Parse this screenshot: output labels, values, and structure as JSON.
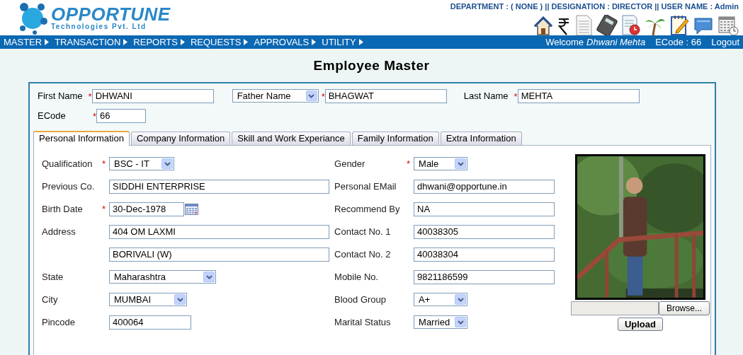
{
  "header": {
    "logo_name": "OPPORTUNE",
    "logo_sub": "Technologies Pvt. Ltd",
    "info": "DEPARTMENT : ( NONE ) || DESIGNATION : DIRECTOR || USER NAME : Admin"
  },
  "menu": [
    "MASTER",
    "TRANSACTION",
    "REPORTS",
    "REQUESTS",
    "APPROVALS",
    "UTILITY"
  ],
  "welcome": {
    "greeting": "Welcome",
    "user": "Dhwani Mehta",
    "ecode": "ECode : 66",
    "logout": "Logout"
  },
  "title": "Employee Master",
  "top_fields": [
    {
      "kind": "label",
      "label": "First Name",
      "required_mark": "*",
      "value": "DHWANI"
    },
    {
      "kind": "select",
      "label": "Father Name",
      "required_mark": "*",
      "value": "BHAGWAT"
    },
    {
      "kind": "label",
      "label": "Last Name",
      "required_mark": "*",
      "value": "MEHTA"
    },
    {
      "kind": "label",
      "label": "ECode",
      "required_mark": "*",
      "value": "66"
    }
  ],
  "tabs": [
    {
      "label": "Personal Information",
      "selected": true
    },
    {
      "label": "Company Information",
      "selected": false
    },
    {
      "label": "Skill and Work Experiance",
      "selected": false
    },
    {
      "label": "Family Information",
      "selected": false
    },
    {
      "label": "Extra Information",
      "selected": false
    }
  ],
  "left_fields": [
    {
      "kind": "select",
      "label": "Qualification",
      "required_mark": "*",
      "value": "BSC - IT"
    },
    {
      "kind": "text",
      "label": "Previous Co.",
      "value": "SIDDHI ENTERPRISE"
    },
    {
      "kind": "date",
      "label": "Birth Date",
      "required_mark": "*",
      "value": "30-Dec-1978"
    },
    {
      "kind": "text",
      "label": "Address",
      "value": "404 OM LAXMI"
    },
    {
      "kind": "text",
      "value": "BORIVALI (W)"
    },
    {
      "kind": "select",
      "label": "State",
      "value": "Maharashtra"
    },
    {
      "kind": "select",
      "label": "City",
      "value": "MUMBAI"
    },
    {
      "kind": "text",
      "label": "Pincode",
      "value": "400064"
    }
  ],
  "right_fields": [
    {
      "kind": "select",
      "label": "Gender",
      "required_mark": "*",
      "value": "Male"
    },
    {
      "kind": "text",
      "label": "Personal EMail",
      "value": "dhwani@opportune.in"
    },
    {
      "kind": "text",
      "label": "Recommend By",
      "value": "NA"
    },
    {
      "kind": "text",
      "label": "Contact No. 1",
      "value": "40038305"
    },
    {
      "kind": "text",
      "label": "Contact No. 2",
      "value": "40038304"
    },
    {
      "kind": "text",
      "label": "Mobile No.",
      "value": "9821186599"
    },
    {
      "kind": "select",
      "label": "Blood Group",
      "value": "A+"
    },
    {
      "kind": "select",
      "label": "Marital Status",
      "value": "Married"
    }
  ],
  "photo": {
    "kind": "picture",
    "browse": "Browse...",
    "upload": "Upload"
  }
}
